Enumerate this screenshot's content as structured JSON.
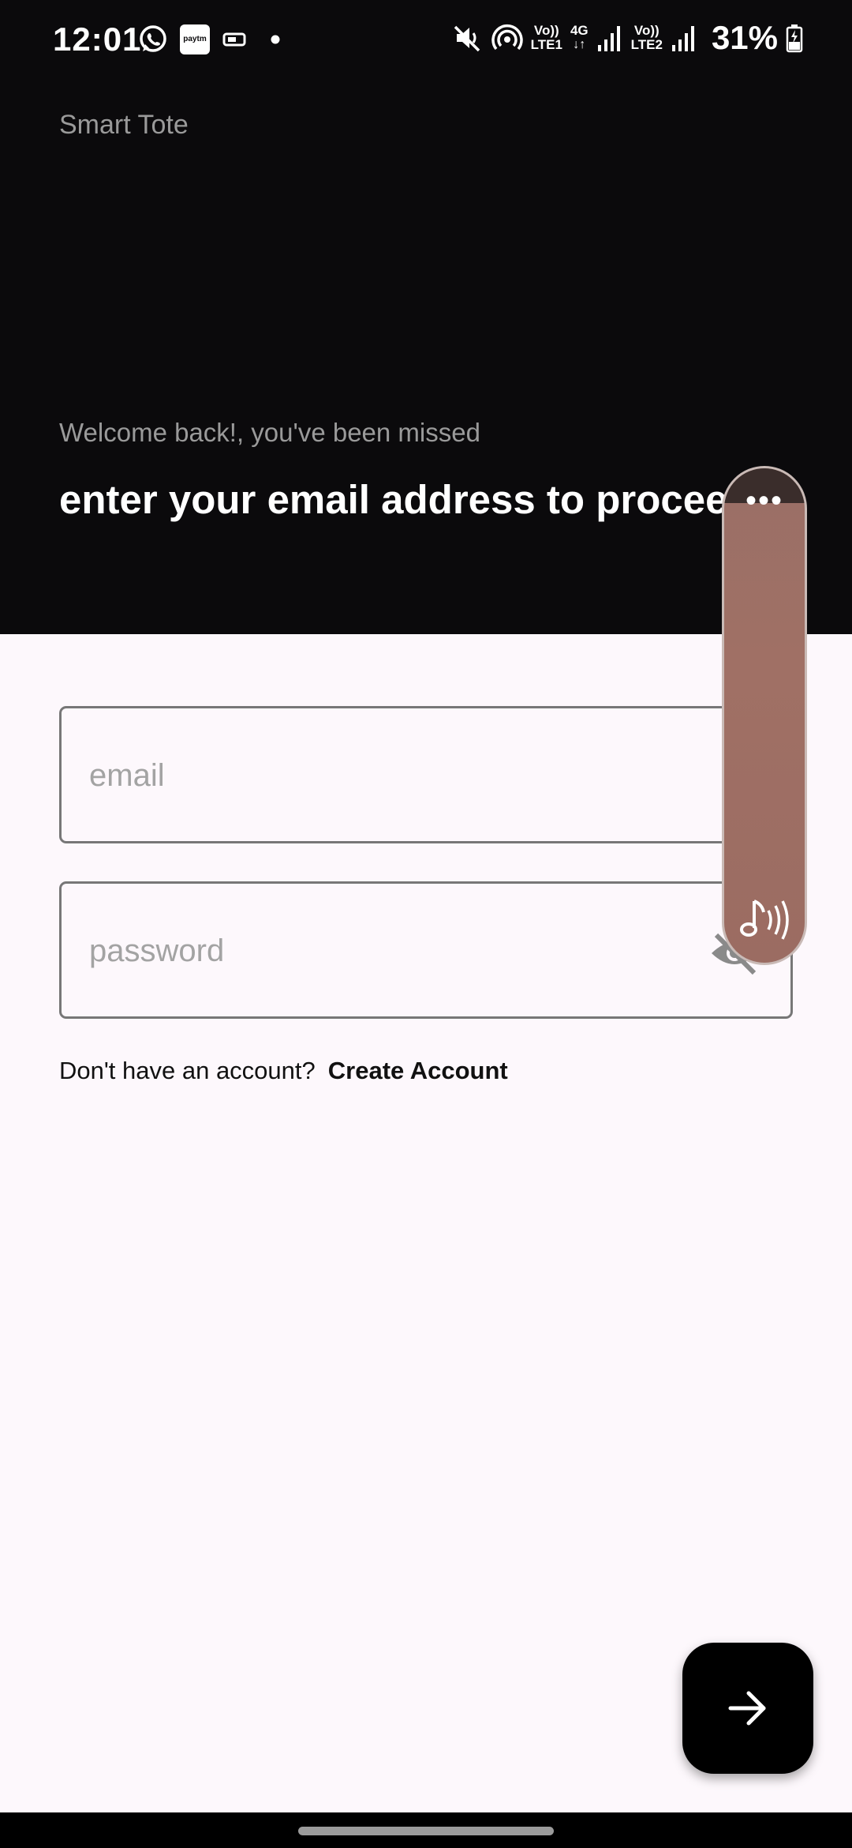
{
  "status_bar": {
    "time": "12:01",
    "battery": "31%",
    "net1_top": "Vo))",
    "net1_bottom": "LTE1",
    "net_4g": "4G",
    "net2_top": "Vo))",
    "net2_bottom": "LTE2",
    "paytm": "paytm",
    "icons": [
      "whatsapp-icon",
      "paytm-icon",
      "screen-record-icon",
      "dot-icon",
      "mute-icon",
      "hotspot-icon",
      "signal-icon",
      "signal-icon",
      "battery-icon"
    ]
  },
  "app": {
    "title": "Smart Tote",
    "welcome": "Welcome back!, you've been missed",
    "headline": "enter your email address to proceed"
  },
  "form": {
    "email_placeholder": "email",
    "password_placeholder": "password",
    "prompt": "Don't have an account?",
    "create_account": "Create Account"
  },
  "widget": {
    "dots": "•••"
  },
  "colors": {
    "top_background": "#0b0a0c",
    "page_background": "#fdf8fc",
    "widget": "#9e6d63",
    "fab": "#000000"
  }
}
